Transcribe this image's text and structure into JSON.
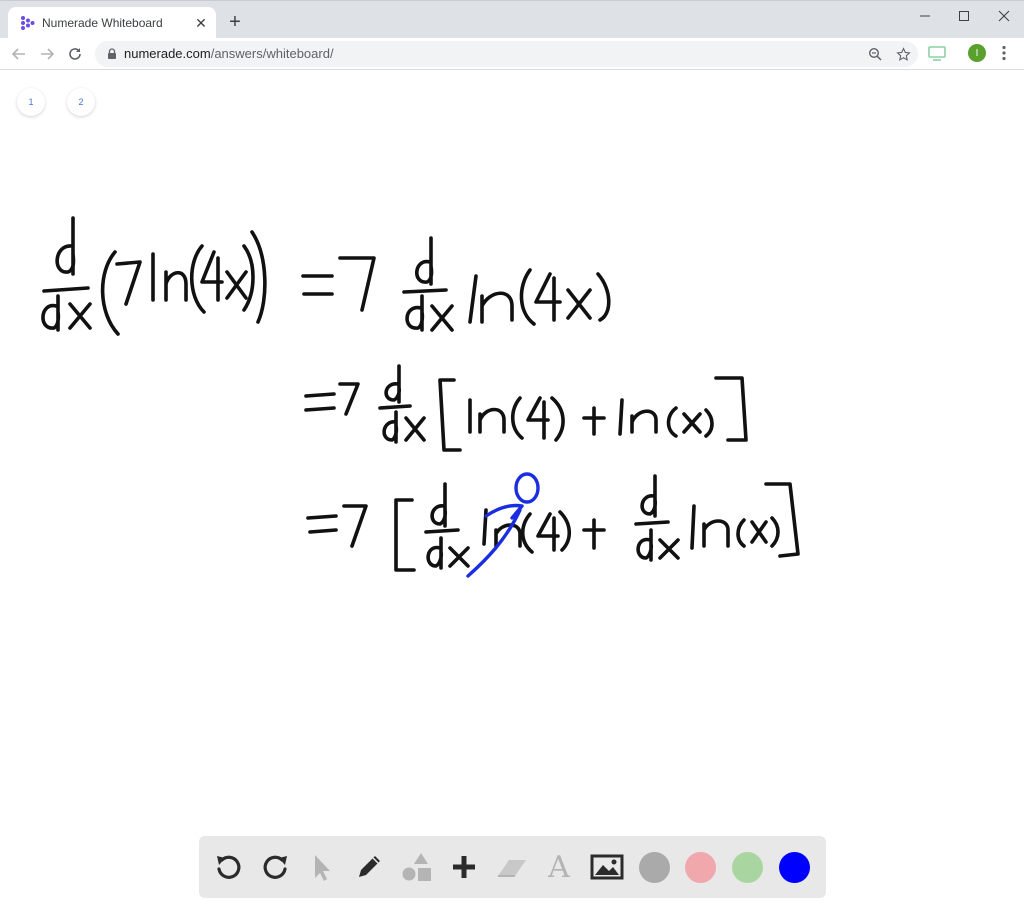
{
  "browser": {
    "tab_title": "Numerade Whiteboard",
    "tab_close": "✕",
    "new_tab": "+",
    "url_host": "numerade.com",
    "url_path": "/answers/whiteboard/",
    "profile_initial": "I"
  },
  "whiteboard": {
    "pages": [
      "1",
      "2"
    ],
    "ink_lines": [
      "d/dx (7 ln(4x)) = 7 d/dx ln(4x)",
      "= 7 d/dx [ ln(4) + ln(x) ]",
      "= 7 [ d/dx ln(4) + d/dx ln(x) ]"
    ],
    "annotation": "0"
  },
  "palette": {
    "tools": [
      "undo-icon",
      "redo-icon",
      "pointer-icon",
      "pen-icon",
      "shapes-icon",
      "plus-icon",
      "eraser-icon",
      "text-tool-icon",
      "image-icon"
    ],
    "text_tool_glyph": "A",
    "colors": [
      "#aaaaaa",
      "#f0a8ac",
      "#a9d6a0",
      "#0000ff"
    ]
  }
}
